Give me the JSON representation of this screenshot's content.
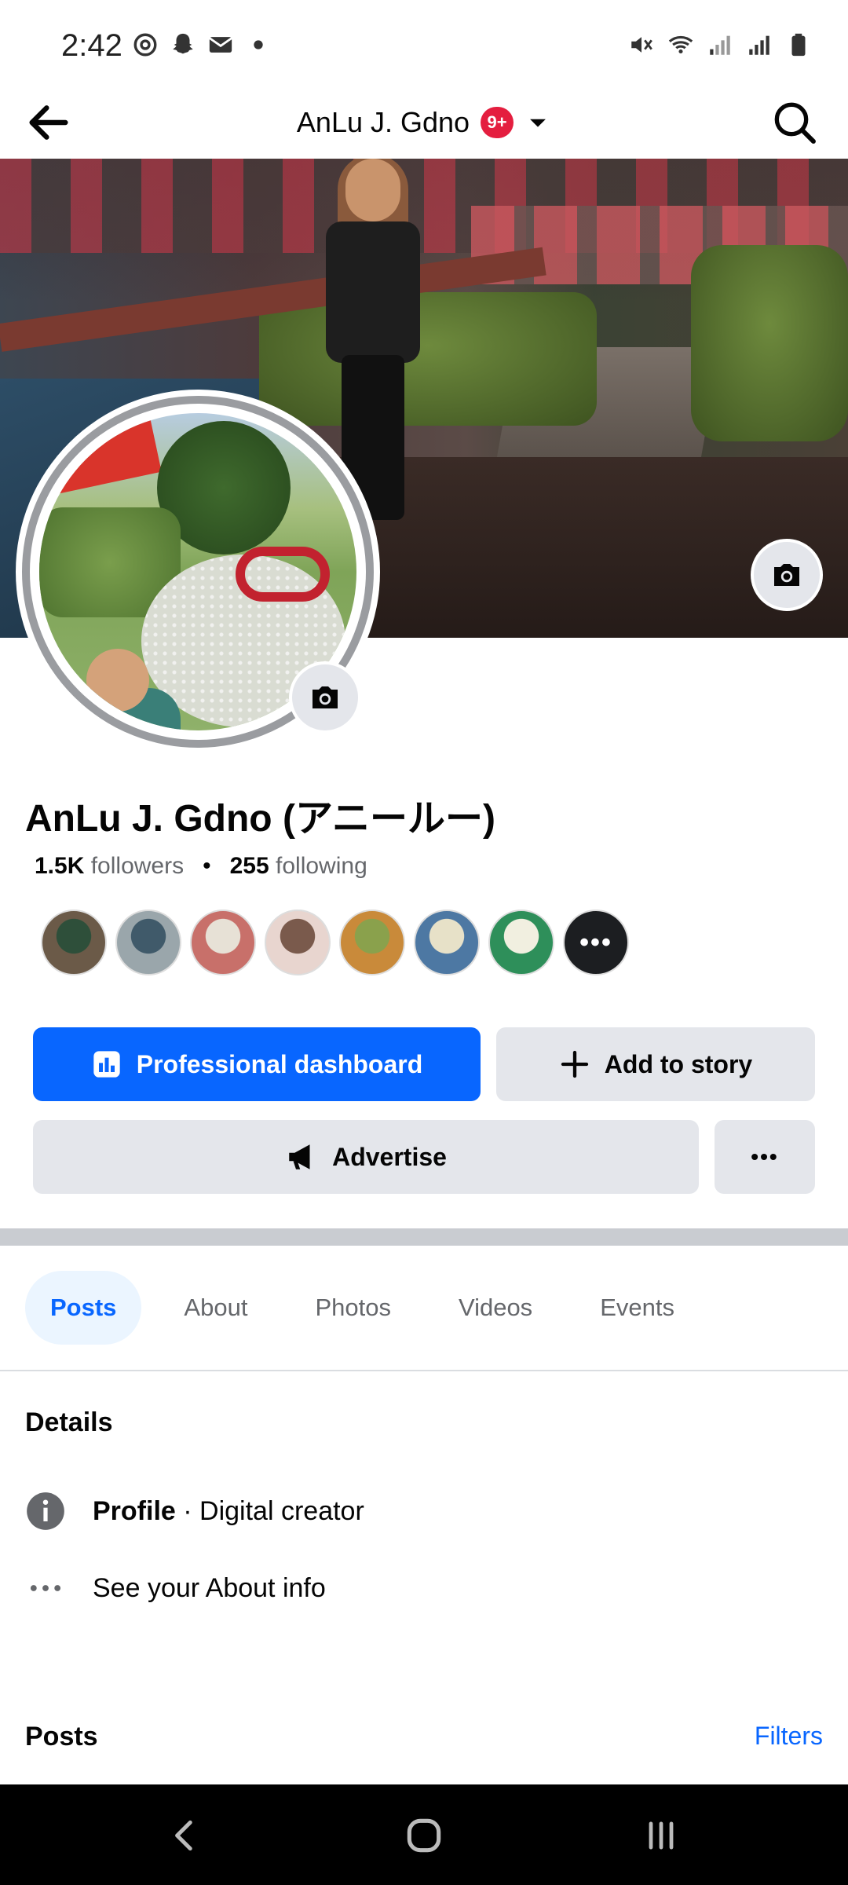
{
  "status_bar": {
    "time": "2:42",
    "left_icons": [
      "sync-icon",
      "snapchat-icon",
      "mail-icon",
      "dot-icon"
    ],
    "right_icons": [
      "mute-icon",
      "wifi-icon",
      "signal-icon",
      "signal-icon",
      "battery-icon"
    ]
  },
  "header": {
    "title": "AnLu J. Gdno",
    "badge": "9+",
    "badge_color": "#e41e3f"
  },
  "profile": {
    "name": "AnLu J. Gdno (アニールー)",
    "followers_count": "1.5K",
    "followers_label": "followers",
    "separator": "•",
    "following_count": "255",
    "following_label": "following",
    "follower_avatars": [
      {
        "colors": [
          "#6b5a48",
          "#2e4f3a"
        ]
      },
      {
        "colors": [
          "#9aa6ab",
          "#405a6a"
        ]
      },
      {
        "colors": [
          "#c8706a",
          "#e7e1d6"
        ]
      },
      {
        "colors": [
          "#e8d5cf",
          "#7a5a4c"
        ]
      },
      {
        "colors": [
          "#c98a3a",
          "#8aa14c"
        ]
      },
      {
        "colors": [
          "#4d78a3",
          "#e7e1c8"
        ]
      },
      {
        "colors": [
          "#2e8f5a",
          "#f1efe0"
        ]
      }
    ],
    "more_label": "•••"
  },
  "buttons": {
    "dashboard": "Professional dashboard",
    "add_story": "Add to story",
    "advertise": "Advertise",
    "more": "•••"
  },
  "colors": {
    "primary": "#0866ff",
    "secondary_bg": "#e4e6eb",
    "tab_active_bg": "#ebf5ff",
    "muted_text": "#65676b"
  },
  "tabs": [
    "Posts",
    "About",
    "Photos",
    "Videos",
    "Events"
  ],
  "active_tab": "Posts",
  "details": {
    "title": "Details",
    "profile_label": "Profile",
    "profile_sep": " · ",
    "profile_value": "Digital creator",
    "about_link": "See your About info"
  },
  "posts": {
    "title": "Posts",
    "filters": "Filters"
  },
  "nav_bar": {
    "buttons": [
      "back-nav-icon",
      "home-nav-icon",
      "recents-nav-icon"
    ]
  }
}
